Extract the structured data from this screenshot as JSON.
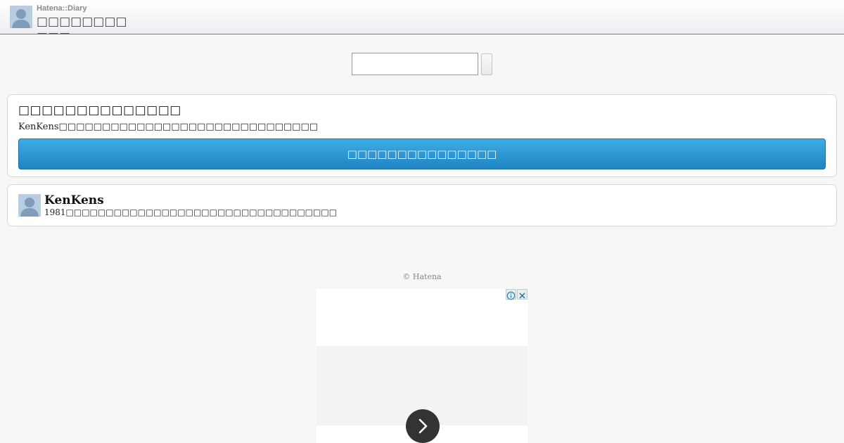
{
  "header": {
    "brand": "Hatena::Diary",
    "title": "□□□□□□□□ □□□"
  },
  "search": {
    "value": "",
    "placeholder": ""
  },
  "follow_card": {
    "heading": "□□□□□□□□□□□□□□",
    "description": "KenKens□□□□□□□□□□□□□□□□□□□□□□□□□□□□□□",
    "button_label": "□□□□□□□□□□□□□□□"
  },
  "profile": {
    "name": "KenKens",
    "bio": "1981□□□□□□□□□□□□□□□□□□□□□□□□□□□□□□□□□□"
  },
  "footer": {
    "copyright": "© Hatena"
  },
  "icons": {
    "avatar": "user-silhouette-icon",
    "ad_info": "info-icon",
    "ad_close": "close-icon",
    "ad_next": "chevron-right-icon"
  },
  "colors": {
    "button_top": "#3eaee6",
    "button_bottom": "#1f84c2",
    "avatar_fill": "#8aa6c1"
  }
}
